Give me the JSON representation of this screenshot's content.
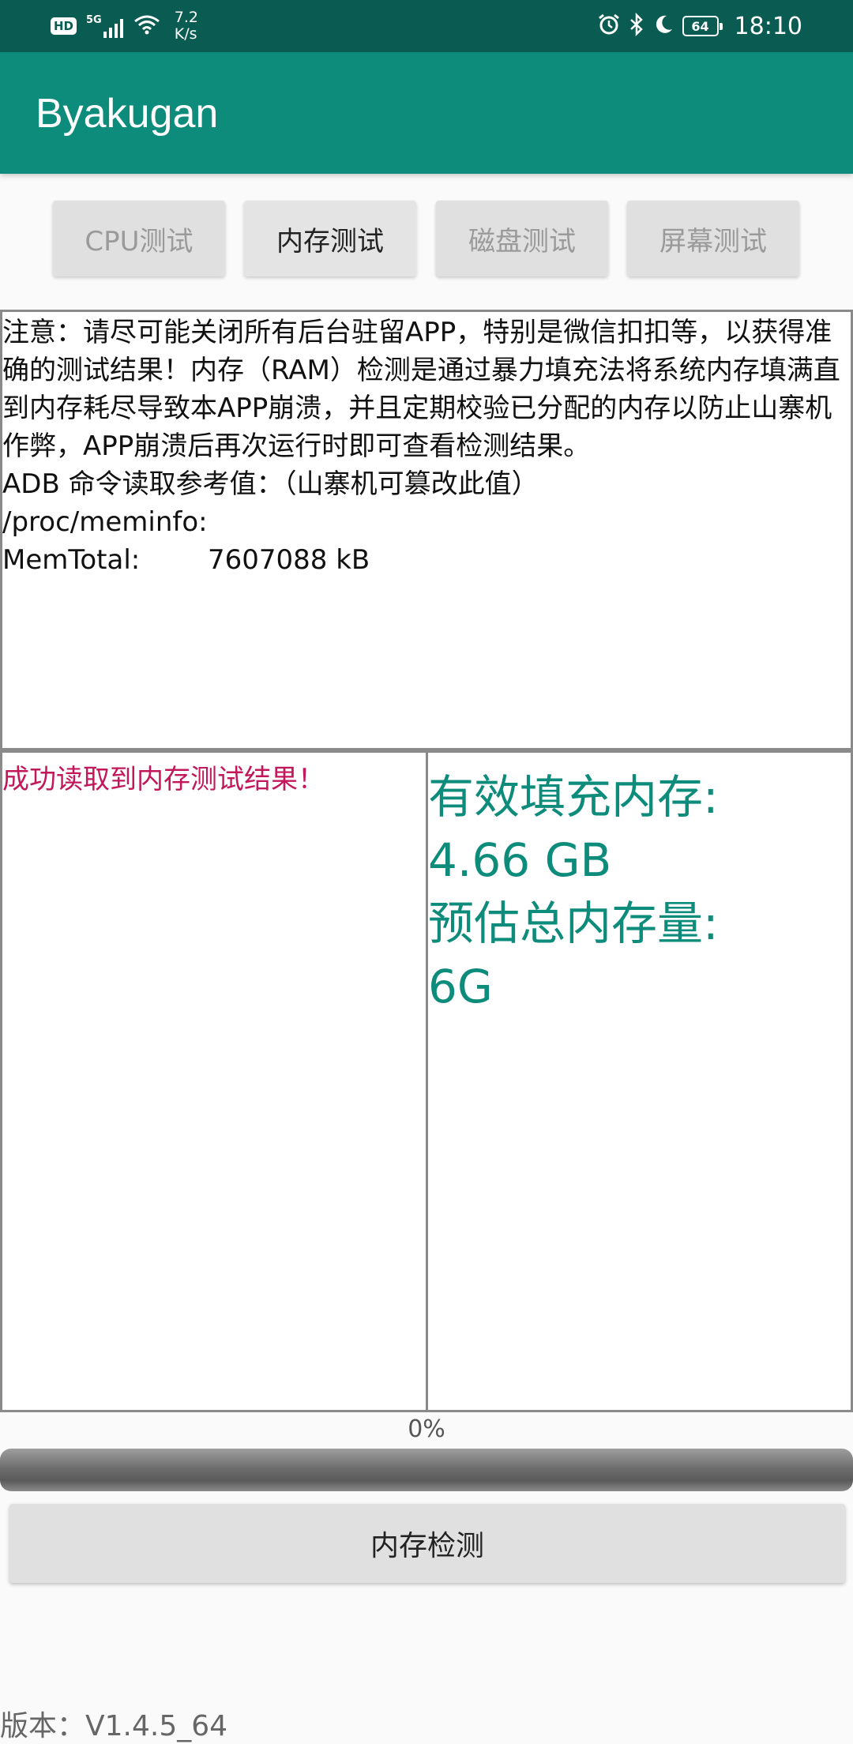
{
  "status_bar": {
    "hd_label": "HD",
    "signal_label": "5G",
    "net_speed_value": "7.2",
    "net_speed_unit": "K/s",
    "battery_level": "64",
    "time": "18:10"
  },
  "app_bar": {
    "title": "Byakugan"
  },
  "tabs": [
    {
      "label": "CPU测试",
      "active": false
    },
    {
      "label": "内存测试",
      "active": true
    },
    {
      "label": "磁盘测试",
      "active": false
    },
    {
      "label": "屏幕测试",
      "active": false
    }
  ],
  "info": {
    "notice": "注意：请尽可能关闭所有后台驻留APP，特别是微信扣扣等，以获得准确的测试结果！内存（RAM）检测是通过暴力填充法将系统内存填满直到内存耗尽导致本APP崩溃，并且定期校验已分配的内存以防止山寨机作弊，APP崩溃后再次运行时即可查看检测结果。",
    "adb_line": "ADB 命令读取参考值：（山寨机可篡改此值）",
    "meminfo_path": "/proc/meminfo:",
    "memtotal_label": "MemTotal:",
    "memtotal_value": "7607088 kB"
  },
  "results": {
    "success_message": "成功读取到内存测试结果！",
    "effective_label": "有效填充内存:",
    "effective_value": "4.66 GB",
    "estimated_label": "预估总内存量:",
    "estimated_value": "6G"
  },
  "progress": {
    "text": "0%",
    "fraction": 0
  },
  "detect_button_label": "内存检测",
  "version": "版本：V1.4.5_64",
  "colors": {
    "status_bar": "#0a5c52",
    "app_bar": "#0d8b7b",
    "result_text": "#0d8b7b",
    "success_text": "#c2185b"
  }
}
